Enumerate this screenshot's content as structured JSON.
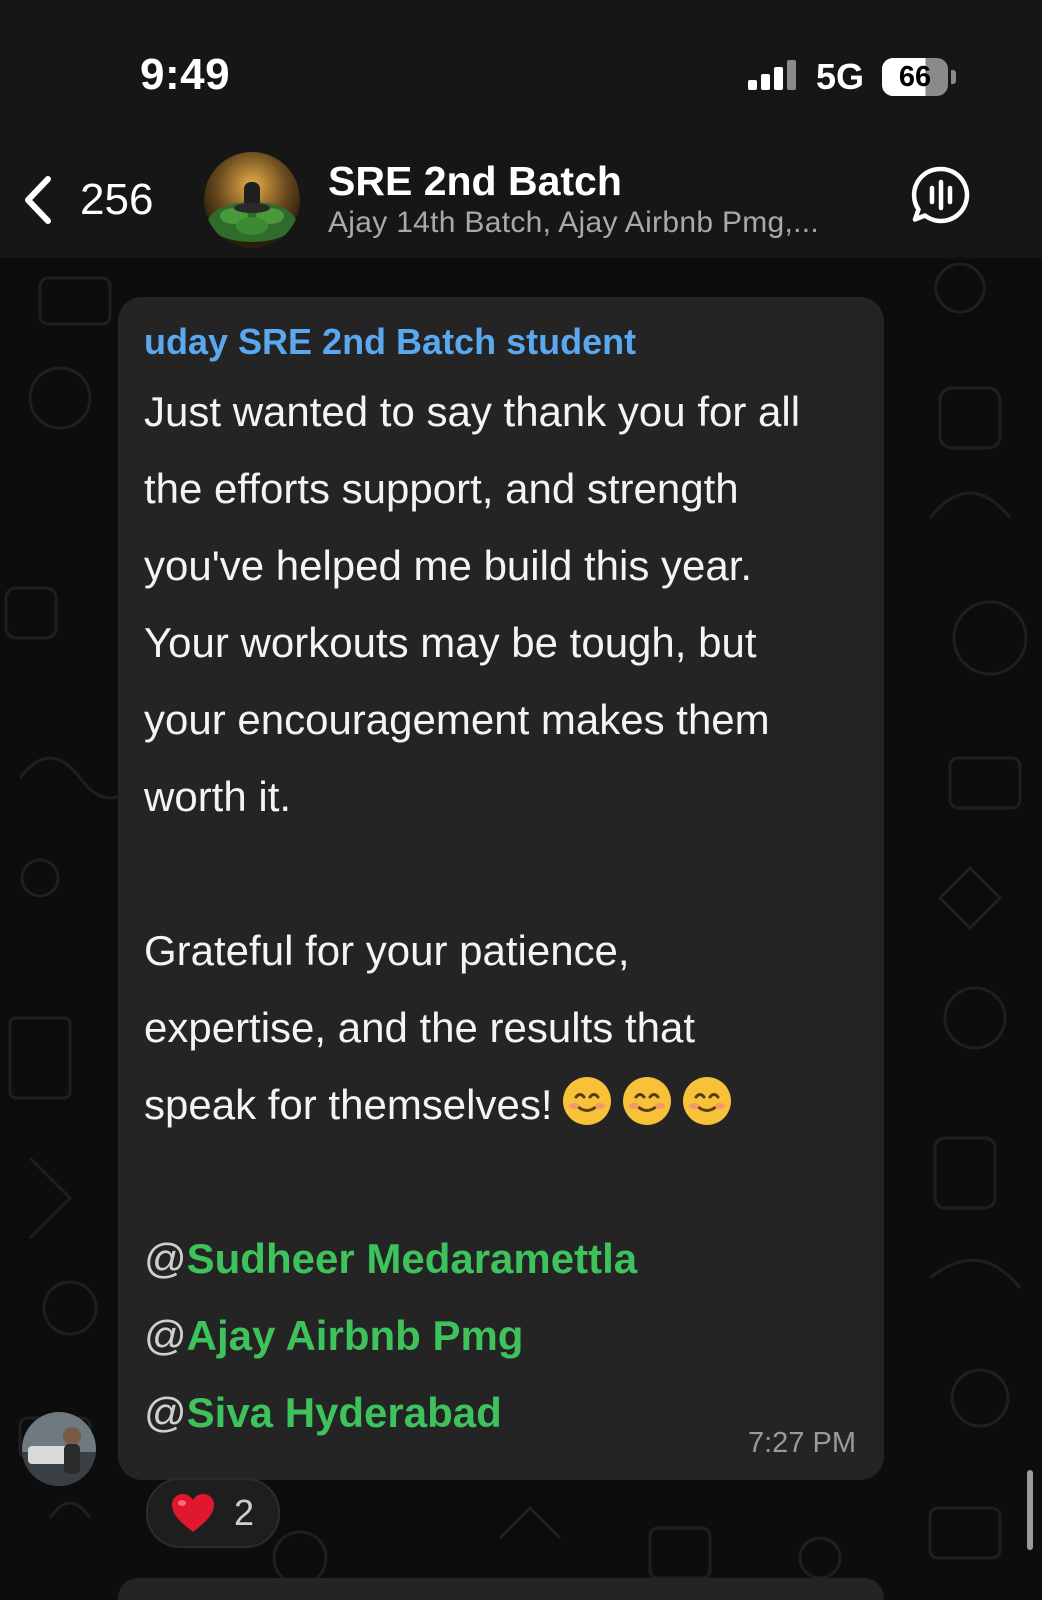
{
  "status_bar": {
    "time": "9:49",
    "network": "5G",
    "battery": "66"
  },
  "header": {
    "back_count": "256",
    "title": "SRE 2nd Batch",
    "subtitle": "Ajay 14th Batch, Ajay Airbnb Pmg,..."
  },
  "message": {
    "sender": "uday SRE 2nd Batch student",
    "paragraph1": [
      "Just wanted to say thank you for all",
      "the efforts support, and strength",
      "you've helped me build this year.",
      "Your workouts may be tough, but",
      "your encouragement makes them",
      "worth it."
    ],
    "paragraph2": [
      "Grateful for your patience,",
      "expertise, and the results that"
    ],
    "last_line": "speak for themselves!",
    "emojis": [
      "smiling-face-icon",
      "smiling-face-icon",
      "smiling-face-icon"
    ],
    "mentions": [
      {
        "at": "@",
        "name": "Sudheer Medaramettla"
      },
      {
        "at": "@",
        "name": "Ajay Airbnb Pmg"
      },
      {
        "at": "@",
        "name": "Siva Hyderabad"
      }
    ],
    "time": "7:27 PM",
    "reaction": {
      "icon": "heart-icon",
      "count": "2"
    }
  },
  "colors": {
    "sender_name": "#5aa8f0",
    "mention": "#3ec25c",
    "bubble": "#242424",
    "header": "#161616"
  }
}
